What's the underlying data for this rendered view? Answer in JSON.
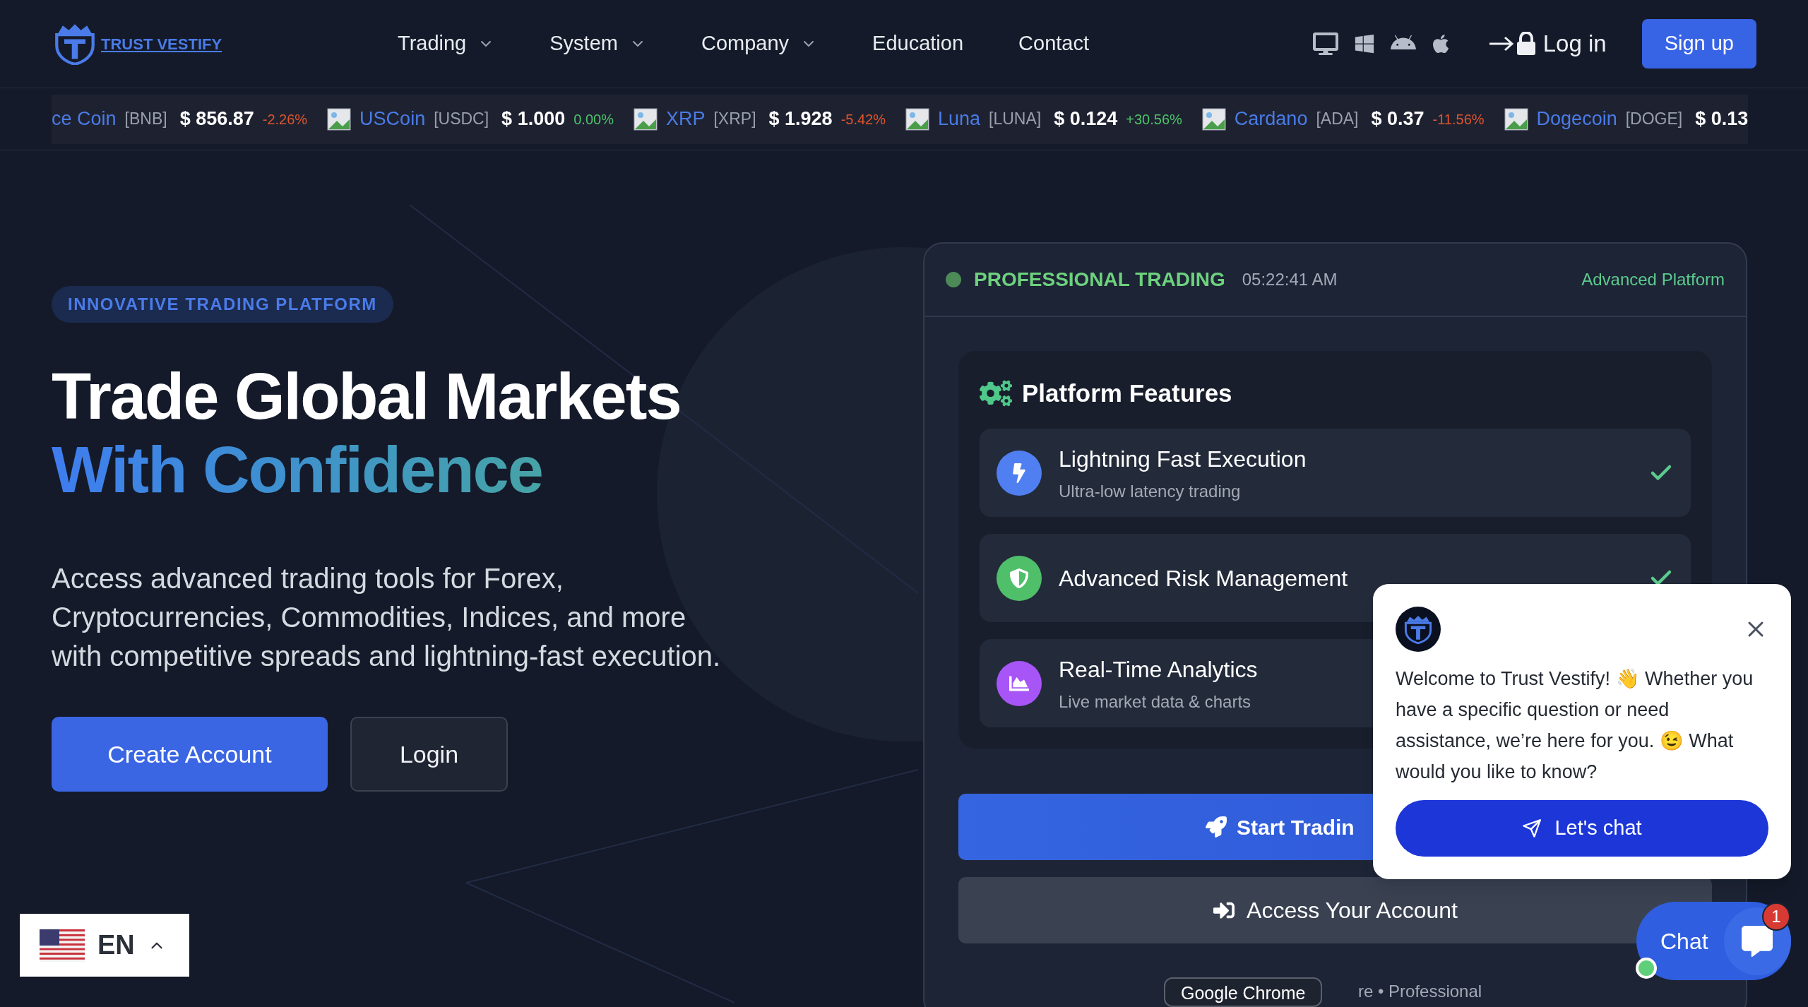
{
  "nav": {
    "logo_text": "TRUST VESTIFY",
    "menu": [
      {
        "label": "Trading",
        "dropdown": true
      },
      {
        "label": "System",
        "dropdown": true
      },
      {
        "label": "Company",
        "dropdown": true
      },
      {
        "label": "Education",
        "dropdown": false
      },
      {
        "label": "Contact",
        "dropdown": false
      }
    ],
    "login": "Log in",
    "signup": "Sign up"
  },
  "ticker": [
    {
      "name": "ce Coin",
      "symbol": "[BNB]",
      "price": "$ 856.87",
      "change": "-2.26%",
      "color": "#e0542c",
      "image": false
    },
    {
      "name": "USCoin",
      "symbol": "[USDC]",
      "price": "$ 1.000",
      "change": "0.00%",
      "color": "#4cc36a",
      "image": true
    },
    {
      "name": "XRP",
      "symbol": "[XRP]",
      "price": "$ 1.928",
      "change": "-5.42%",
      "color": "#e0542c",
      "image": true
    },
    {
      "name": "Luna",
      "symbol": "[LUNA]",
      "price": "$ 0.124",
      "change": "+30.56%",
      "color": "#4cc36a",
      "image": true
    },
    {
      "name": "Cardano",
      "symbol": "[ADA]",
      "price": "$ 0.37",
      "change": "-11.56%",
      "color": "#e0542c",
      "image": true
    },
    {
      "name": "Dogecoin",
      "symbol": "[DOGE]",
      "price": "$ 0.13",
      "image": true
    }
  ],
  "hero": {
    "badge": "INNOVATIVE TRADING PLATFORM",
    "title_line1": "Trade Global Markets",
    "title_line2": "With Confidence",
    "description": "Access advanced trading tools for Forex, Cryptocurrencies, Commodities, Indices, and more with competitive spreads and lightning-fast execution.",
    "primary_button": "Create Account",
    "secondary_button": "Login"
  },
  "panel": {
    "status": "PROFESSIONAL TRADING",
    "time": "05:22:41 AM",
    "tag": "Advanced Platform",
    "features_title": "Platform Features",
    "features": [
      {
        "title": "Lightning Fast Execution",
        "subtitle": "Ultra-low latency trading",
        "color": "#4f7ff0",
        "checked": true
      },
      {
        "title": "Advanced Risk Management",
        "color": "#4fbf6a",
        "checked": true
      },
      {
        "title": "Real-Time Analytics",
        "subtitle": "Live market data & charts",
        "color": "#a855f7",
        "checked": false
      }
    ],
    "start_button": "Start Tradin",
    "access_button": "Access Your Account",
    "footer": "re • Professional"
  },
  "chat_popup": {
    "message": "Welcome to Trust Vestify! 👋 Whether you have a specific question or need assistance, we’re here for you. 😉 What would you like to know?",
    "button": "Let's chat"
  },
  "chat_launcher": {
    "label": "Chat",
    "badge": "1",
    "online": true
  },
  "language": {
    "code": "EN"
  },
  "tooltip": "Google Chrome"
}
